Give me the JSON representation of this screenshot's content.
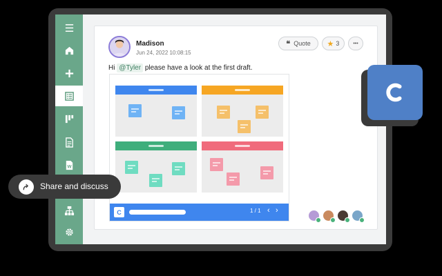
{
  "post": {
    "author": "Madison",
    "timestamp": "Jun 24, 2022 10:08:15",
    "message_prefix": "Hi ",
    "mention": "@Tyler",
    "message_suffix": " please have a look at the first draft.",
    "quote_label": "Quote",
    "star_count": "3",
    "more_label": "•••"
  },
  "board_footer": {
    "logo_letter": "C",
    "page_indicator": "1 / 1",
    "prev": "‹",
    "next": "›"
  },
  "share": {
    "label": "Share and discuss"
  },
  "colors": {
    "sidebar": "#6aa78a",
    "q1": "#3f86ee",
    "q2": "#f6a623",
    "q3": "#3fae7c",
    "q4": "#f06b7c",
    "note_blue": "#6fb3f5",
    "note_orange": "#f5c06a",
    "note_green": "#6fdcc1",
    "note_pink": "#f49aaa",
    "app_icon": "#4f80c7"
  },
  "sidebar_icons": [
    "menu-icon",
    "home-icon",
    "plus-icon",
    "list-icon",
    "kanban-icon",
    "document-icon",
    "word-icon",
    "text-icon",
    "sitemap-icon",
    "settings-icon"
  ]
}
